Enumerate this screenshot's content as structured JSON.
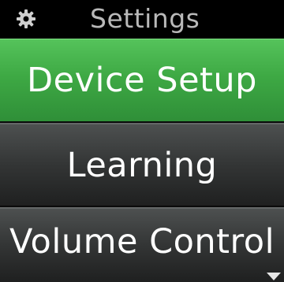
{
  "header": {
    "icon": "gear-icon",
    "title": "Settings"
  },
  "menu": {
    "items": [
      {
        "label": "Device Setup",
        "selected": true
      },
      {
        "label": "Learning",
        "selected": false
      },
      {
        "label": "Volume Control",
        "selected": false
      }
    ],
    "more_below_icon": "chevron-down-icon"
  },
  "colors": {
    "selected_bg": "#3ea944",
    "item_bg": "#333535",
    "header_bg": "#000000",
    "title_text": "#b9b9b9",
    "item_text": "#ffffff"
  }
}
